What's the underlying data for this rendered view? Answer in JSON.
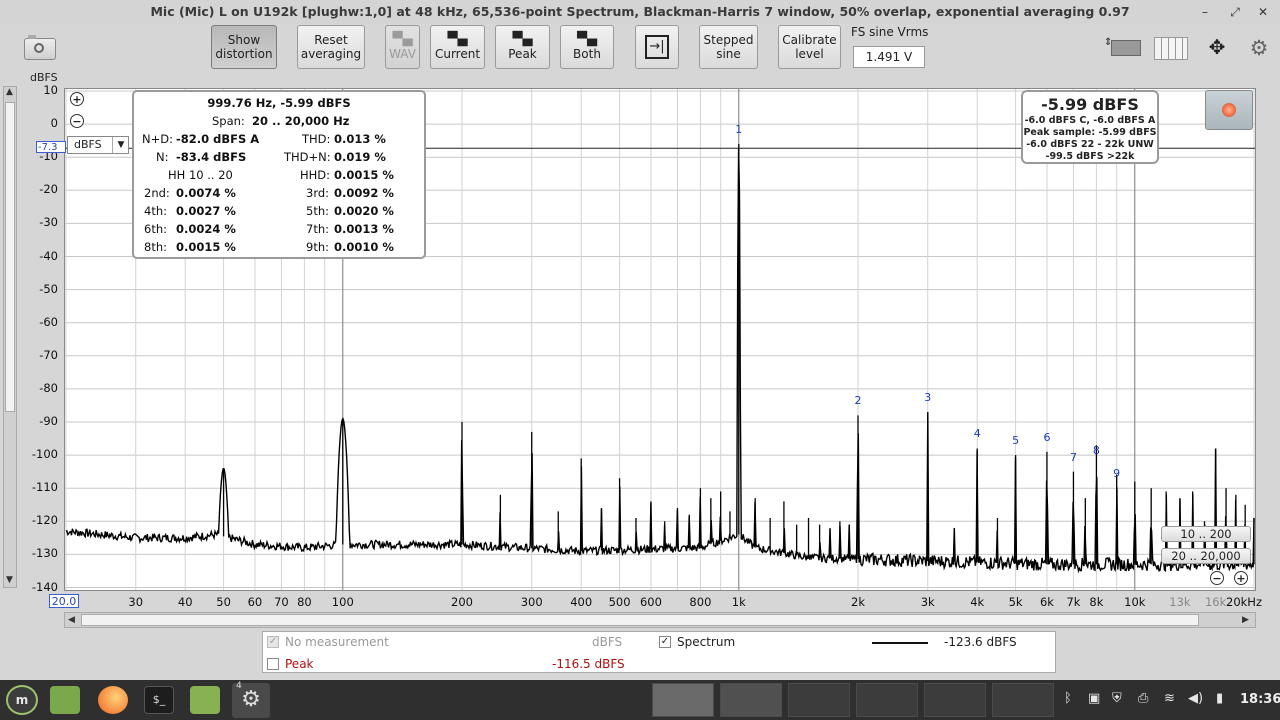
{
  "window": {
    "title": "Mic (Mic) L on U192k [plughw:1,0] at 48 kHz, 65,536-point Spectrum, Blackman-Harris 7 window, 50% overlap, exponential averaging 0.97",
    "controls": {
      "minimize": "–",
      "restore": "⤢",
      "close": "✕"
    }
  },
  "toolbar": {
    "snapshot_icon": "camera-icon",
    "buttons": [
      {
        "id": "show-distortion",
        "lines": [
          "Show",
          "distortion"
        ],
        "state": "pressed"
      },
      {
        "id": "reset-averaging",
        "lines": [
          "Reset",
          "averaging"
        ],
        "state": "normal"
      },
      {
        "id": "wav",
        "lines": [
          "WAV"
        ],
        "icon": "save-icon",
        "state": "disabled"
      },
      {
        "id": "current",
        "lines": [
          "Current"
        ],
        "icon": "save-icon",
        "state": "normal"
      },
      {
        "id": "peak",
        "lines": [
          "Peak"
        ],
        "icon": "save-icon",
        "state": "normal"
      },
      {
        "id": "both",
        "lines": [
          "Both"
        ],
        "icon": "save-icon",
        "state": "normal"
      },
      {
        "id": "input",
        "lines": [],
        "icon": "input-icon",
        "state": "normal"
      },
      {
        "id": "stepped-sine",
        "lines": [
          "Stepped",
          "sine"
        ],
        "state": "normal"
      },
      {
        "id": "calibrate-level",
        "lines": [
          "Calibrate",
          "level"
        ],
        "state": "normal"
      }
    ],
    "fs_sine_label": "FS sine Vrms",
    "fs_sine_value": "1.491 V"
  },
  "plot": {
    "y_unit": "dBFS",
    "unit_select": "dBFS",
    "y_ticks": [
      "10",
      "0",
      "-10",
      "-20",
      "-30",
      "-40",
      "-50",
      "-60",
      "-70",
      "-80",
      "-90",
      "-100",
      "-110",
      "-120",
      "-130",
      "-140"
    ],
    "reference_line_label": "-7.3",
    "x_start_label": "20.0",
    "x_ticks": [
      {
        "label": "30",
        "f": 30
      },
      {
        "label": "40",
        "f": 40
      },
      {
        "label": "50",
        "f": 50
      },
      {
        "label": "60",
        "f": 60
      },
      {
        "label": "70",
        "f": 70
      },
      {
        "label": "80",
        "f": 80
      },
      {
        "label": "100",
        "f": 100
      },
      {
        "label": "200",
        "f": 200
      },
      {
        "label": "300",
        "f": 300
      },
      {
        "label": "400",
        "f": 400
      },
      {
        "label": "500",
        "f": 500
      },
      {
        "label": "600",
        "f": 600
      },
      {
        "label": "800",
        "f": 800
      },
      {
        "label": "1k",
        "f": 1000
      },
      {
        "label": "2k",
        "f": 2000
      },
      {
        "label": "3k",
        "f": 3000
      },
      {
        "label": "4k",
        "f": 4000
      },
      {
        "label": "5k",
        "f": 5000
      },
      {
        "label": "6k",
        "f": 6000
      },
      {
        "label": "7k",
        "f": 7000
      },
      {
        "label": "8k",
        "f": 8000
      },
      {
        "label": "10k",
        "f": 10000
      },
      {
        "label": "13k",
        "f": 13000,
        "faded": true
      },
      {
        "label": "16k",
        "f": 16000,
        "faded": true
      },
      {
        "label": "20kHz",
        "f": 20000
      }
    ],
    "harmonic_markers": [
      {
        "label": "1",
        "f": 1000,
        "db": -6
      },
      {
        "label": "2",
        "f": 2000,
        "db": -88
      },
      {
        "label": "3",
        "f": 3000,
        "db": -87
      },
      {
        "label": "4",
        "f": 4000,
        "db": -98
      },
      {
        "label": "5",
        "f": 5000,
        "db": -100
      },
      {
        "label": "6",
        "f": 6000,
        "db": -99
      },
      {
        "label": "7",
        "f": 7000,
        "db": -105
      },
      {
        "label": "8",
        "f": 8000,
        "db": -103
      },
      {
        "label": "9",
        "f": 9000,
        "db": -110
      }
    ],
    "zoom_in_icon": "zoom-in-icon",
    "zoom_out_icon": "zoom-out-icon",
    "range_buttons": [
      "10 .. 200",
      "20 .. 20,000"
    ]
  },
  "chart_data": {
    "type": "line",
    "xlabel": "",
    "ylabel": "dBFS",
    "x_scale": "log",
    "xlim": [
      20,
      20000
    ],
    "ylim": [
      -140,
      10
    ],
    "grid": true,
    "series": [
      {
        "name": "Spectrum",
        "noise_floor": [
          [
            20,
            -123
          ],
          [
            30,
            -125
          ],
          [
            40,
            -125
          ],
          [
            48,
            -124
          ],
          [
            60,
            -127
          ],
          [
            80,
            -128
          ],
          [
            100,
            -127
          ],
          [
            200,
            -127
          ],
          [
            400,
            -129
          ],
          [
            800,
            -128
          ],
          [
            1000,
            -124
          ],
          [
            1100,
            -128
          ],
          [
            1500,
            -131
          ],
          [
            3000,
            -132
          ],
          [
            6000,
            -133
          ],
          [
            10000,
            -133
          ],
          [
            20000,
            -133
          ]
        ],
        "peaks": [
          {
            "f": 50,
            "db": -104
          },
          {
            "f": 100,
            "db": -89
          },
          {
            "f": 200,
            "db": -90
          },
          {
            "f": 250,
            "db": -112
          },
          {
            "f": 300,
            "db": -93
          },
          {
            "f": 350,
            "db": -117
          },
          {
            "f": 400,
            "db": -101
          },
          {
            "f": 450,
            "db": -116
          },
          {
            "f": 500,
            "db": -107
          },
          {
            "f": 550,
            "db": -119
          },
          {
            "f": 600,
            "db": -114
          },
          {
            "f": 650,
            "db": -120
          },
          {
            "f": 700,
            "db": -116
          },
          {
            "f": 750,
            "db": -118
          },
          {
            "f": 800,
            "db": -110
          },
          {
            "f": 850,
            "db": -113
          },
          {
            "f": 900,
            "db": -111
          },
          {
            "f": 950,
            "db": -117
          },
          {
            "f": 1000,
            "db": -6
          },
          {
            "f": 1100,
            "db": -113
          },
          {
            "f": 1200,
            "db": -119
          },
          {
            "f": 1300,
            "db": -114
          },
          {
            "f": 1400,
            "db": -121
          },
          {
            "f": 1500,
            "db": -119
          },
          {
            "f": 1600,
            "db": -121
          },
          {
            "f": 1700,
            "db": -122
          },
          {
            "f": 1800,
            "db": -120
          },
          {
            "f": 1900,
            "db": -121
          },
          {
            "f": 2000,
            "db": -88
          },
          {
            "f": 3000,
            "db": -87
          },
          {
            "f": 3500,
            "db": -122
          },
          {
            "f": 4000,
            "db": -98
          },
          {
            "f": 4500,
            "db": -119
          },
          {
            "f": 5000,
            "db": -100
          },
          {
            "f": 6000,
            "db": -99
          },
          {
            "f": 7000,
            "db": -105
          },
          {
            "f": 7500,
            "db": -113
          },
          {
            "f": 8000,
            "db": -97
          },
          {
            "f": 9000,
            "db": -106
          },
          {
            "f": 10000,
            "db": -108
          },
          {
            "f": 11000,
            "db": -110
          },
          {
            "f": 12000,
            "db": -111
          },
          {
            "f": 13000,
            "db": -113
          },
          {
            "f": 14000,
            "db": -111
          },
          {
            "f": 15000,
            "db": -120
          },
          {
            "f": 16000,
            "db": -98
          },
          {
            "f": 17000,
            "db": -110
          },
          {
            "f": 18000,
            "db": -112
          },
          {
            "f": 19000,
            "db": -115
          },
          {
            "f": 20000,
            "db": -119
          }
        ]
      }
    ]
  },
  "distortion": {
    "freq_line": "999.76 Hz, -5.99 dBFS",
    "span_label": "Span:",
    "span_value": "20 .. 20,000 Hz",
    "nd_label": "N+D:",
    "nd_value": "-82.0 dBFS A",
    "thd_label": "THD:",
    "thd_value": "0.013 %",
    "n_label": "N:",
    "n_value": "-83.4 dBFS",
    "thdn_label": "THD+N:",
    "thdn_value": "0.019 %",
    "hh_label": "HH 10 .. 20",
    "hhd_label": "HHD:",
    "hhd_value": "0.0015 %",
    "harmonics": [
      {
        "l1": "2nd:",
        "v1": "0.0074 %",
        "l2": "3rd:",
        "v2": "0.0092 %"
      },
      {
        "l1": "4th:",
        "v1": "0.0027 %",
        "l2": "5th:",
        "v2": "0.0020 %"
      },
      {
        "l1": "6th:",
        "v1": "0.0024 %",
        "l2": "7th:",
        "v2": "0.0013 %"
      },
      {
        "l1": "8th:",
        "v1": "0.0015 %",
        "l2": "9th:",
        "v2": "0.0010 %"
      }
    ]
  },
  "level": {
    "main": "-5.99 dBFS",
    "line1": "-6.0 dBFS C, -6.0 dBFS A",
    "line2": "Peak sample: -5.99 dBFS",
    "line3": "-6.0 dBFS 22 - 22k UNW",
    "line4": "-99.5 dBFS >22k"
  },
  "legend": {
    "no_measurement": "No measurement",
    "no_measurement_unit": "dBFS",
    "spectrum": "Spectrum",
    "spectrum_value": "-123.6 dBFS",
    "peak": "Peak",
    "peak_value": "-116.5 dBFS",
    "peak_color": "#b01010"
  },
  "taskbar": {
    "clock": "18:36",
    "workspace_badge": "4",
    "apps": [
      "menu-icon",
      "files-icon",
      "firefox-icon",
      "terminal-icon",
      "folder-icon",
      "settings-icon"
    ],
    "tray": [
      "bluetooth-icon",
      "clipboard-icon",
      "shield-icon",
      "printer-icon",
      "wifi-icon",
      "volume-icon",
      "battery-icon"
    ]
  }
}
